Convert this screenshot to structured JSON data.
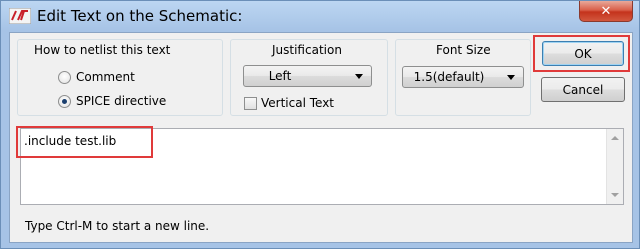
{
  "window": {
    "title": "Edit Text on the Schematic:",
    "close_glyph": "✕"
  },
  "netlist_group": {
    "label": "How to netlist this text",
    "options": [
      {
        "label": "Comment",
        "checked": false
      },
      {
        "label": "SPICE directive",
        "checked": true
      }
    ]
  },
  "justification_group": {
    "label": "Justification",
    "selected": "Left",
    "vertical_text_label": "Vertical Text",
    "vertical_text_checked": false
  },
  "font_size_group": {
    "label": "Font Size",
    "selected": "1.5(default)"
  },
  "buttons": {
    "ok_label": "OK",
    "cancel_label": "Cancel"
  },
  "editor": {
    "value": ".include test.lib"
  },
  "hint": "Type Ctrl-M to start a new line.",
  "colors": {
    "highlight": "#e03a3a",
    "app_icon": "#c8202a"
  },
  "icons": {
    "app": "ltspice-icon",
    "close": "close-icon"
  }
}
